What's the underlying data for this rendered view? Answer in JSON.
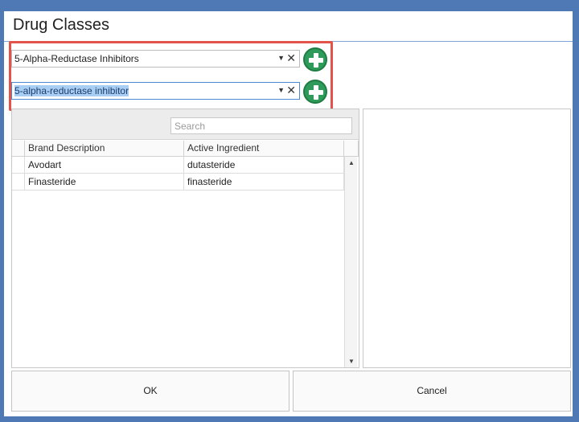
{
  "window": {
    "title": "Drug Classes"
  },
  "selectors": [
    {
      "value": "5-Alpha-Reductase Inhibitors",
      "arrow_icon": "▼",
      "clear_icon": "✕"
    },
    {
      "value": "5-alpha-reductase inhibitor",
      "arrow_icon": "▼",
      "clear_icon": "✕"
    }
  ],
  "grid": {
    "search_placeholder": "Search",
    "columns": [
      "Brand Description",
      "Active Ingredient"
    ],
    "rows": [
      {
        "brand": "Avodart",
        "ingredient": "dutasteride"
      },
      {
        "brand": "Finasteride",
        "ingredient": "finasteride"
      }
    ],
    "scroll_up_icon": "▲",
    "scroll_down_icon": "▼"
  },
  "buttons": {
    "ok": "OK",
    "cancel": "Cancel"
  },
  "colors": {
    "accent_green": "#2e9b5b",
    "highlight_red": "#e2534b",
    "selection_blue": "#a9cef3",
    "frame_blue": "#4e79b4"
  }
}
